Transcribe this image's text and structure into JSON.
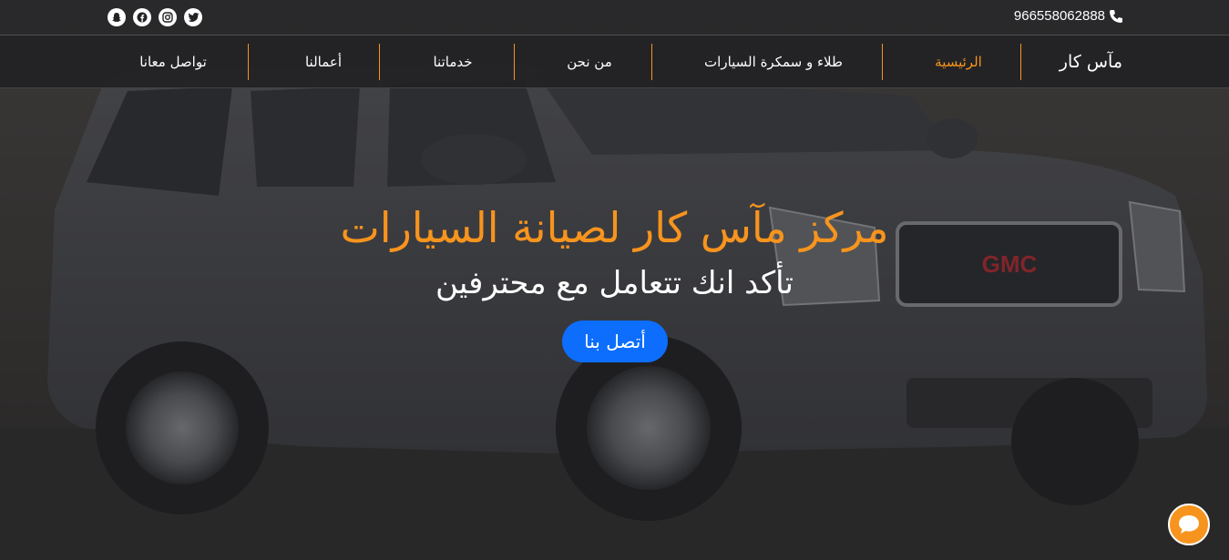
{
  "topbar": {
    "phone": "966558062888",
    "phone_icon": "phone-icon",
    "socials": [
      "twitter-icon",
      "instagram-icon",
      "facebook-icon",
      "snapchat-icon"
    ]
  },
  "nav": {
    "brand": "مآس كار",
    "items": [
      {
        "label": "الرئيسية",
        "active": true
      },
      {
        "label": "طلاء و سمكرة السيارات",
        "active": false
      },
      {
        "label": "من نحن",
        "active": false
      },
      {
        "label": "خدماتنا",
        "active": false
      },
      {
        "label": "أعمالنا",
        "active": false
      },
      {
        "label": "تواصل معانا",
        "active": false
      }
    ]
  },
  "hero": {
    "title": "مركز مآس كار لصيانة السيارات",
    "subtitle": "تأكد انك تتعامل مع محترفين",
    "cta_label": "أتصل بنا",
    "grille_badge": "GMC"
  },
  "chat": {
    "icon": "chat-bubble-icon"
  },
  "colors": {
    "accent": "#f7941d",
    "cta": "#0d6efd",
    "overlay": "#222224"
  }
}
